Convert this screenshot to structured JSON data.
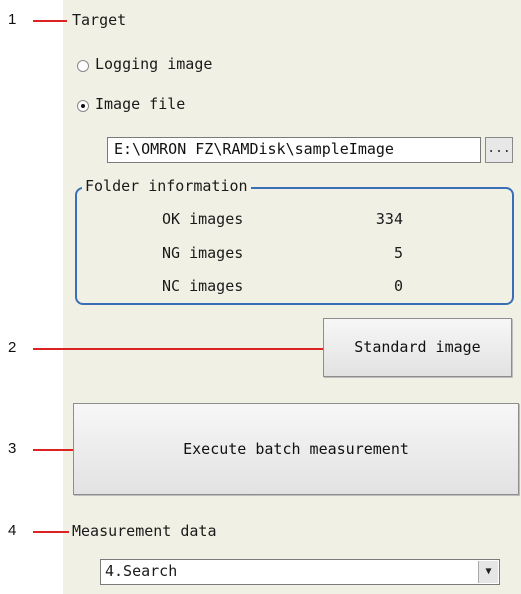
{
  "callouts": [
    {
      "number": "1"
    },
    {
      "number": "2"
    },
    {
      "number": "3"
    },
    {
      "number": "4"
    }
  ],
  "target": {
    "heading": "Target",
    "options": [
      {
        "label": "Logging image",
        "selected": false
      },
      {
        "label": "Image file",
        "selected": true
      }
    ],
    "path_value": "E:\\OMRON FZ\\RAMDisk\\sampleImage",
    "browse_label": "..."
  },
  "folder_info": {
    "title": "Folder information",
    "rows": [
      {
        "label": "OK images",
        "value": "334"
      },
      {
        "label": "NG images",
        "value": "5"
      },
      {
        "label": "NC images",
        "value": "0"
      }
    ]
  },
  "standard_image_button": "Standard image",
  "execute_button": "Execute batch measurement",
  "measurement": {
    "heading": "Measurement data",
    "selected": "4.Search"
  },
  "colors": {
    "panel_bg": "#f1f0e4",
    "callout_line": "#dd2222",
    "group_border": "#3a6fb8"
  }
}
